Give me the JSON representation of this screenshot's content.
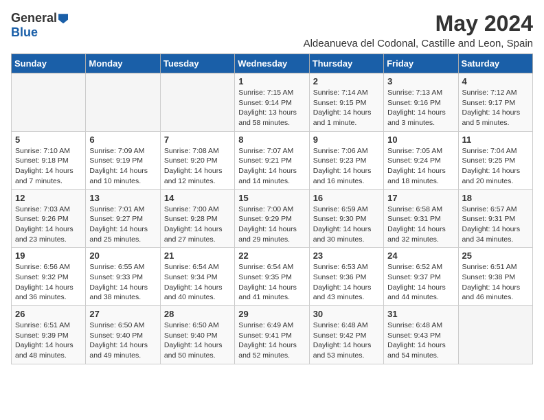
{
  "header": {
    "logo_general": "General",
    "logo_blue": "Blue",
    "title": "May 2024",
    "subtitle": "Aldeanueva del Codonal, Castille and Leon, Spain"
  },
  "weekdays": [
    "Sunday",
    "Monday",
    "Tuesday",
    "Wednesday",
    "Thursday",
    "Friday",
    "Saturday"
  ],
  "weeks": [
    [
      {
        "day": "",
        "info": ""
      },
      {
        "day": "",
        "info": ""
      },
      {
        "day": "",
        "info": ""
      },
      {
        "day": "1",
        "info": "Sunrise: 7:15 AM\nSunset: 9:14 PM\nDaylight: 13 hours\nand 58 minutes."
      },
      {
        "day": "2",
        "info": "Sunrise: 7:14 AM\nSunset: 9:15 PM\nDaylight: 14 hours\nand 1 minute."
      },
      {
        "day": "3",
        "info": "Sunrise: 7:13 AM\nSunset: 9:16 PM\nDaylight: 14 hours\nand 3 minutes."
      },
      {
        "day": "4",
        "info": "Sunrise: 7:12 AM\nSunset: 9:17 PM\nDaylight: 14 hours\nand 5 minutes."
      }
    ],
    [
      {
        "day": "5",
        "info": "Sunrise: 7:10 AM\nSunset: 9:18 PM\nDaylight: 14 hours\nand 7 minutes."
      },
      {
        "day": "6",
        "info": "Sunrise: 7:09 AM\nSunset: 9:19 PM\nDaylight: 14 hours\nand 10 minutes."
      },
      {
        "day": "7",
        "info": "Sunrise: 7:08 AM\nSunset: 9:20 PM\nDaylight: 14 hours\nand 12 minutes."
      },
      {
        "day": "8",
        "info": "Sunrise: 7:07 AM\nSunset: 9:21 PM\nDaylight: 14 hours\nand 14 minutes."
      },
      {
        "day": "9",
        "info": "Sunrise: 7:06 AM\nSunset: 9:23 PM\nDaylight: 14 hours\nand 16 minutes."
      },
      {
        "day": "10",
        "info": "Sunrise: 7:05 AM\nSunset: 9:24 PM\nDaylight: 14 hours\nand 18 minutes."
      },
      {
        "day": "11",
        "info": "Sunrise: 7:04 AM\nSunset: 9:25 PM\nDaylight: 14 hours\nand 20 minutes."
      }
    ],
    [
      {
        "day": "12",
        "info": "Sunrise: 7:03 AM\nSunset: 9:26 PM\nDaylight: 14 hours\nand 23 minutes."
      },
      {
        "day": "13",
        "info": "Sunrise: 7:01 AM\nSunset: 9:27 PM\nDaylight: 14 hours\nand 25 minutes."
      },
      {
        "day": "14",
        "info": "Sunrise: 7:00 AM\nSunset: 9:28 PM\nDaylight: 14 hours\nand 27 minutes."
      },
      {
        "day": "15",
        "info": "Sunrise: 7:00 AM\nSunset: 9:29 PM\nDaylight: 14 hours\nand 29 minutes."
      },
      {
        "day": "16",
        "info": "Sunrise: 6:59 AM\nSunset: 9:30 PM\nDaylight: 14 hours\nand 30 minutes."
      },
      {
        "day": "17",
        "info": "Sunrise: 6:58 AM\nSunset: 9:31 PM\nDaylight: 14 hours\nand 32 minutes."
      },
      {
        "day": "18",
        "info": "Sunrise: 6:57 AM\nSunset: 9:31 PM\nDaylight: 14 hours\nand 34 minutes."
      }
    ],
    [
      {
        "day": "19",
        "info": "Sunrise: 6:56 AM\nSunset: 9:32 PM\nDaylight: 14 hours\nand 36 minutes."
      },
      {
        "day": "20",
        "info": "Sunrise: 6:55 AM\nSunset: 9:33 PM\nDaylight: 14 hours\nand 38 minutes."
      },
      {
        "day": "21",
        "info": "Sunrise: 6:54 AM\nSunset: 9:34 PM\nDaylight: 14 hours\nand 40 minutes."
      },
      {
        "day": "22",
        "info": "Sunrise: 6:54 AM\nSunset: 9:35 PM\nDaylight: 14 hours\nand 41 minutes."
      },
      {
        "day": "23",
        "info": "Sunrise: 6:53 AM\nSunset: 9:36 PM\nDaylight: 14 hours\nand 43 minutes."
      },
      {
        "day": "24",
        "info": "Sunrise: 6:52 AM\nSunset: 9:37 PM\nDaylight: 14 hours\nand 44 minutes."
      },
      {
        "day": "25",
        "info": "Sunrise: 6:51 AM\nSunset: 9:38 PM\nDaylight: 14 hours\nand 46 minutes."
      }
    ],
    [
      {
        "day": "26",
        "info": "Sunrise: 6:51 AM\nSunset: 9:39 PM\nDaylight: 14 hours\nand 48 minutes."
      },
      {
        "day": "27",
        "info": "Sunrise: 6:50 AM\nSunset: 9:40 PM\nDaylight: 14 hours\nand 49 minutes."
      },
      {
        "day": "28",
        "info": "Sunrise: 6:50 AM\nSunset: 9:40 PM\nDaylight: 14 hours\nand 50 minutes."
      },
      {
        "day": "29",
        "info": "Sunrise: 6:49 AM\nSunset: 9:41 PM\nDaylight: 14 hours\nand 52 minutes."
      },
      {
        "day": "30",
        "info": "Sunrise: 6:48 AM\nSunset: 9:42 PM\nDaylight: 14 hours\nand 53 minutes."
      },
      {
        "day": "31",
        "info": "Sunrise: 6:48 AM\nSunset: 9:43 PM\nDaylight: 14 hours\nand 54 minutes."
      },
      {
        "day": "",
        "info": ""
      }
    ]
  ]
}
